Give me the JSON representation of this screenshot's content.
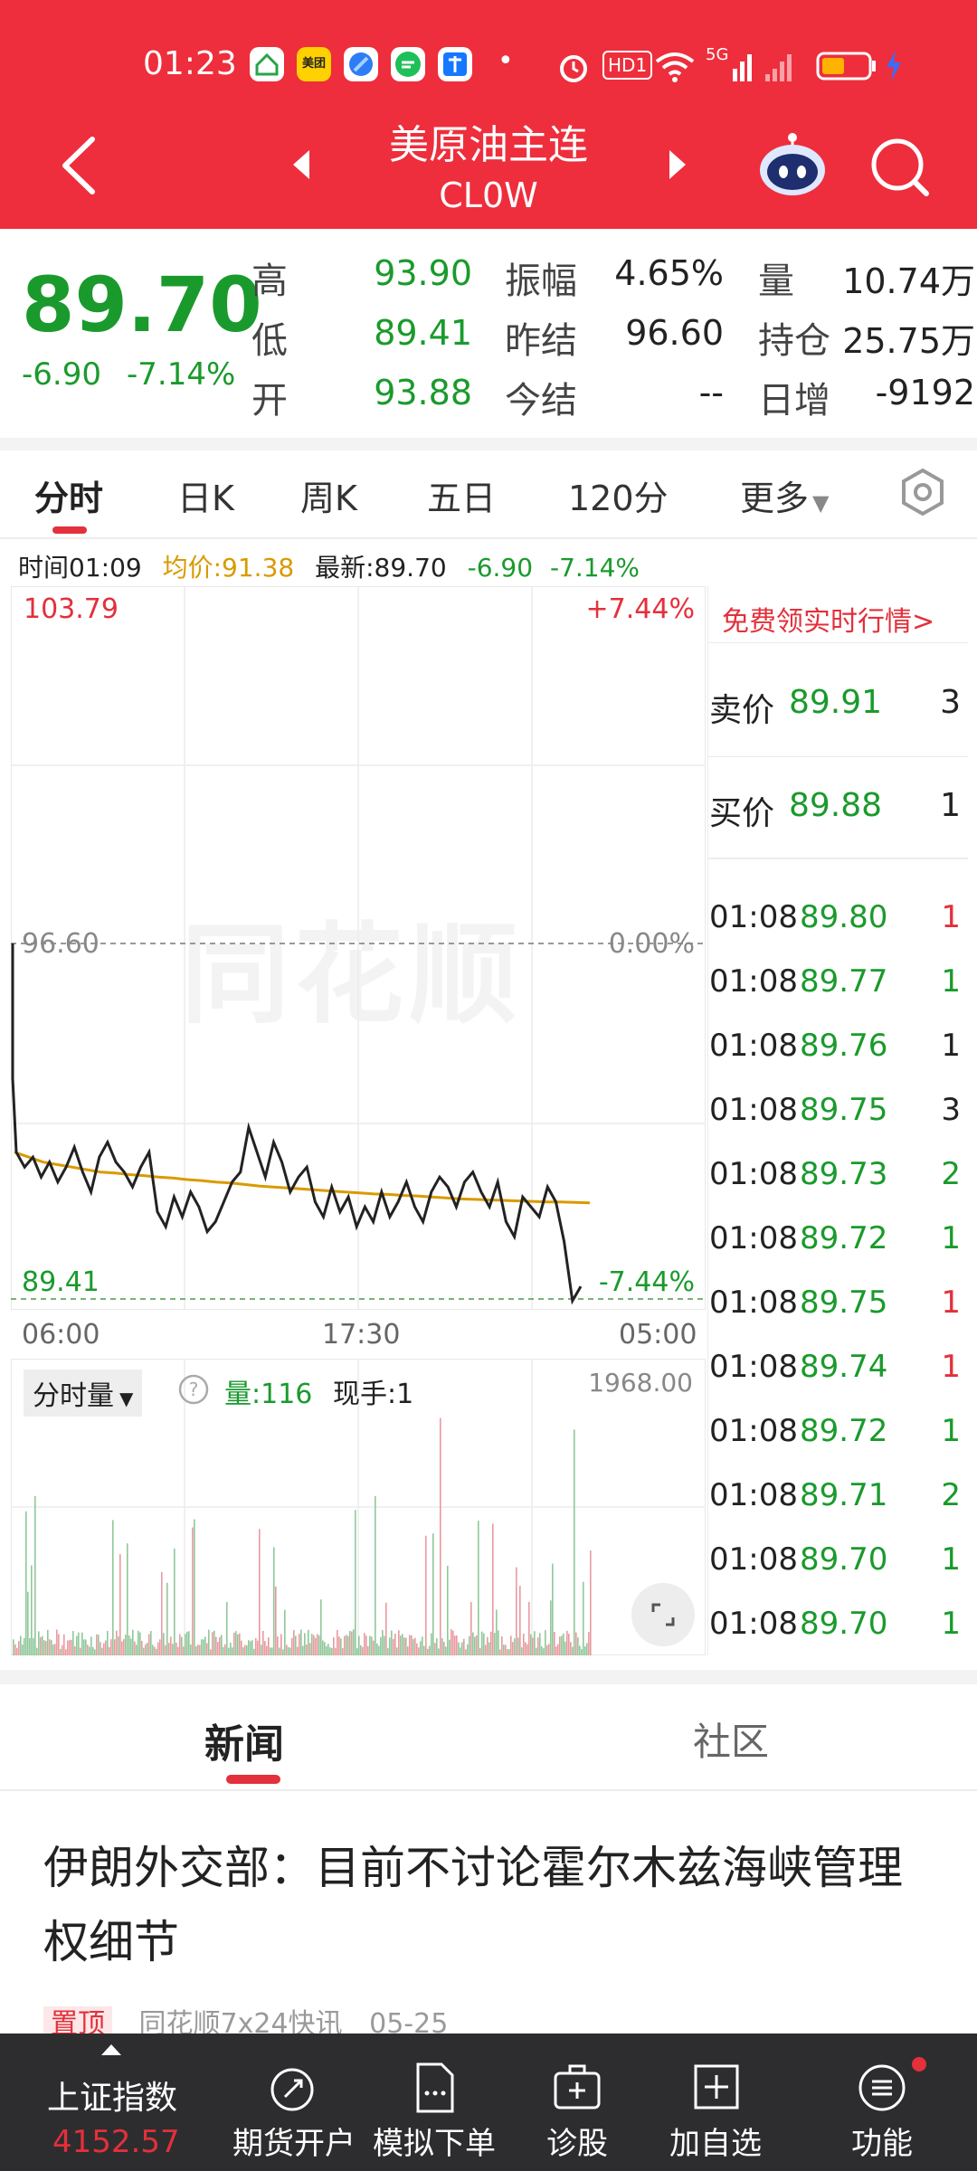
{
  "status": {
    "time": "01:23",
    "app_icons": [
      "home-app-icon",
      "meituan-app-icon",
      "browser-app-icon",
      "message-app-icon",
      "alipay-app-icon"
    ],
    "meituan_text": "美团",
    "dot": "•",
    "hd_badge": "HD1",
    "network": "5G"
  },
  "header": {
    "title": "美原油主连",
    "code": "CL0W"
  },
  "quote": {
    "price": "89.70",
    "change": "-6.90",
    "change_pct": "-7.14%",
    "high_label": "高",
    "high": "93.90",
    "low_label": "低",
    "low": "89.41",
    "open_label": "开",
    "open": "93.88",
    "amp_label": "振幅",
    "amp": "4.65%",
    "prev_settle_label": "昨结",
    "prev_settle": "96.60",
    "settle_label": "今结",
    "settle": "--",
    "vol_label": "量",
    "vol": "10.74万",
    "oi_label": "持仓",
    "oi": "25.75万",
    "daily_inc_label": "日增",
    "daily_inc": "-9192"
  },
  "tabs": [
    "分时",
    "日K",
    "周K",
    "五日",
    "120分",
    "更多"
  ],
  "info_line": {
    "time": "时间01:09",
    "avg": "均价:91.38",
    "latest": "最新:89.70",
    "chg": "-6.90",
    "pct": "-7.14%"
  },
  "chart_data": {
    "type": "line",
    "y_top_label": "103.79",
    "y_mid_label": "96.60",
    "y_bottom_label": "89.41",
    "pct_top": "+7.44%",
    "pct_mid": "0.00%",
    "pct_bottom": "-7.44%",
    "x_tick_labels": [
      "06:00",
      "17:30",
      "05:00"
    ],
    "ylim": [
      89.41,
      103.79
    ],
    "prev_settle": 96.6,
    "price": [
      93.88,
      92.4,
      92.1,
      92.3,
      91.9,
      92.2,
      91.8,
      92.1,
      92.5,
      92.0,
      91.6,
      92.3,
      92.6,
      92.2,
      92.0,
      91.7,
      92.1,
      92.4,
      91.2,
      90.9,
      91.5,
      91.1,
      91.6,
      91.3,
      90.8,
      91.0,
      91.4,
      91.8,
      92.0,
      92.9,
      92.4,
      91.9,
      92.6,
      92.2,
      91.6,
      91.9,
      92.1,
      91.4,
      91.1,
      91.7,
      91.2,
      91.5,
      90.9,
      91.3,
      91.0,
      91.6,
      91.1,
      91.4,
      91.8,
      91.3,
      91.0,
      91.6,
      91.9,
      91.7,
      91.3,
      91.8,
      92.0,
      91.6,
      91.3,
      91.8,
      91.0,
      90.7,
      91.5,
      91.3,
      91.1,
      91.7,
      91.4,
      90.6,
      89.41,
      89.7
    ],
    "avg": [
      92.4,
      92.3,
      92.2,
      92.15,
      92.1,
      92.05,
      92.0,
      91.98,
      91.95,
      91.93,
      91.9,
      91.88,
      91.85,
      91.83,
      91.8,
      91.78,
      91.75,
      91.72,
      91.7,
      91.68,
      91.66,
      91.64,
      91.62,
      91.6,
      91.58,
      91.56,
      91.55,
      91.53,
      91.52,
      91.5,
      91.48,
      91.46,
      91.45,
      91.44,
      91.43,
      91.42,
      91.41,
      91.4,
      91.4,
      91.39,
      91.38
    ],
    "volume_max_label": "1968.00",
    "volume_label": "分时量",
    "volume_value": "量:116",
    "hand_value": "现手:1",
    "volume_ylim": [
      0,
      1968
    ]
  },
  "promo": "免费领实时行情>",
  "book": {
    "ask_label": "卖价",
    "ask": "89.91",
    "ask_qty": "3",
    "bid_label": "买价",
    "bid": "89.88",
    "bid_qty": "1"
  },
  "ticks": [
    {
      "time": "01:08",
      "price": "89.80",
      "qty": "1",
      "dir": "up"
    },
    {
      "time": "01:08",
      "price": "89.77",
      "qty": "1",
      "dir": "down"
    },
    {
      "time": "01:08",
      "price": "89.76",
      "qty": "1",
      "dir": "flat"
    },
    {
      "time": "01:08",
      "price": "89.75",
      "qty": "3",
      "dir": "flat"
    },
    {
      "time": "01:08",
      "price": "89.73",
      "qty": "2",
      "dir": "down"
    },
    {
      "time": "01:08",
      "price": "89.72",
      "qty": "1",
      "dir": "down"
    },
    {
      "time": "01:08",
      "price": "89.75",
      "qty": "1",
      "dir": "up"
    },
    {
      "time": "01:08",
      "price": "89.74",
      "qty": "1",
      "dir": "up"
    },
    {
      "time": "01:08",
      "price": "89.72",
      "qty": "1",
      "dir": "down"
    },
    {
      "time": "01:08",
      "price": "89.71",
      "qty": "2",
      "dir": "down"
    },
    {
      "time": "01:08",
      "price": "89.70",
      "qty": "1",
      "dir": "down"
    },
    {
      "time": "01:08",
      "price": "89.70",
      "qty": "1",
      "dir": "down"
    }
  ],
  "watermark": "同花顺",
  "news": {
    "tab_news": "新闻",
    "tab_community": "社区",
    "headline": "伊朗外交部：目前不讨论霍尔木兹海峡管理权细节",
    "pin": "置顶",
    "source": "同花顺7x24快讯",
    "date": "05-25"
  },
  "bottom_nav": {
    "index_name": "上证指数",
    "index_value": "4152.57",
    "items": [
      "期货开户",
      "模拟下单",
      "诊股",
      "加自选",
      "功能"
    ]
  },
  "colors": {
    "accent": "#ee2e3c",
    "up": "#e3303b",
    "down": "#1a9a2c",
    "avg_line": "#d99a00"
  }
}
